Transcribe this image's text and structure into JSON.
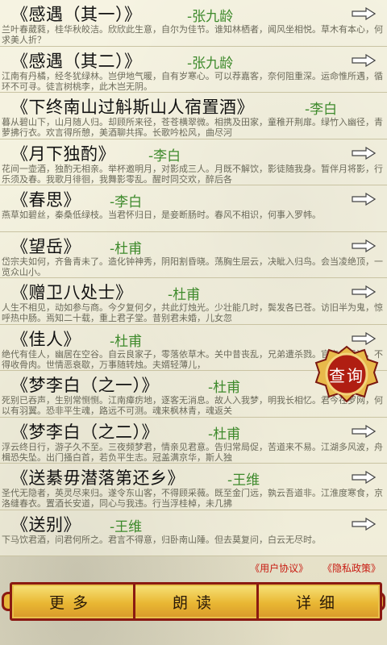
{
  "poems": [
    {
      "title": "《感遇（其一）》",
      "author": "-张九龄",
      "excerpt": "兰叶春葳蕤，桂华秋皎洁。欣欣此生意，自尔为佳节。谁知林栖者，闻风坐相悦。草木有本心，何求美人折？"
    },
    {
      "title": "《感遇（其二）》",
      "author": "-张九龄",
      "excerpt": "江南有丹橘，经冬犹绿林。岂伊地气暖，自有岁寒心。可以荐嘉客，奈何阻重深。运命惟所遇，循环不可寻。徒言树桃李，此木岂无阴。"
    },
    {
      "title": "《下终南山过斛斯山人宿置酒》",
      "author": "-李白",
      "excerpt": "暮从碧山下，山月随人归。却顾所来径，苍苍横翠微。相携及田家，童稚开荆扉。绿竹入幽径，青萝拂行衣。欢言得所憩，美酒聊共挥。长歌吟松风，曲尽河"
    },
    {
      "title": "《月下独酌》",
      "author": "-李白",
      "excerpt": "花间一壶酒，独酌无相亲。举杯邀明月，对影成三人。月既不解饮，影徒随我身。暂伴月将影，行乐须及春。我歌月徘徊，我舞影零乱。醒时同交欢，醉后各"
    },
    {
      "title": "《春思》",
      "author": "-李白",
      "excerpt": "燕草如碧丝，秦桑低绿枝。当君怀归日，是妾断肠时。春风不相识，何事入罗帏。"
    },
    {
      "title": "《望岳》",
      "author": "-杜甫",
      "excerpt": "岱宗夫如何，齐鲁青未了。造化钟神秀，阴阳割昏晓。荡胸生层云，决眦入归鸟。会当凌绝顶，一览众山小。"
    },
    {
      "title": "《赠卫八处士》",
      "author": "-杜甫",
      "excerpt": "人生不相见，动如参与商。今夕复何夕，共此灯烛光。少壮能几时，鬓发各已苍。访旧半为鬼，惊呼热中肠。焉知二十载，重上君子堂。昔别君未婚，儿女忽"
    },
    {
      "title": "《佳人》",
      "author": "-杜甫",
      "excerpt": "绝代有佳人，幽居在空谷。自云良家子，零落依草木。关中昔丧乱，兄弟遭杀戮。官高何足论，不得收骨肉。世情恶衰歇，万事随转烛。夫婿轻薄儿，"
    },
    {
      "title": "《梦李白（之一）》",
      "author": "-杜甫",
      "excerpt": "死别已吞声，生别常恻恻。江南瘴疠地，逐客无消息。故人入我梦，明我长相忆。君今在罗网，何以有羽翼。恐非平生魂，路远不可测。魂来枫林青，魂返关"
    },
    {
      "title": "《梦李白（之二）》",
      "author": "-杜甫",
      "excerpt": "浮云终日行，游子久不至。三夜频梦君，情亲见君意。告归常局促，苦道来不易。江湖多风波，舟楫恐失坠。出门搔白首，若负平生志。冠盖满京华，斯人独"
    },
    {
      "title": "《送綦毋潜落第还乡》",
      "author": "-王维",
      "excerpt": "圣代无隐者，英灵尽来归。遂令东山客，不得顾采薇。既至金门远，孰云吾道非。江淮度寒食，京洛缝春衣。置酒长安道，同心与我违。行当浮桂棹，未几拂"
    },
    {
      "title": "《送别》",
      "author": "-王维",
      "excerpt": "下马饮君酒，问君何所之。君言不得意，归卧南山陲。但去莫复问，白云无尽时。"
    }
  ],
  "links": {
    "agreement": "《用户协议》",
    "privacy": "《隐私政策》"
  },
  "toolbar": {
    "more": "更多",
    "read": "朗读",
    "detail": "详细"
  },
  "query_button": "查询",
  "colors": {
    "author": "#3e8a2c",
    "link": "#c81a10",
    "frame": "#8a1a12",
    "gold": "#e9b733"
  }
}
